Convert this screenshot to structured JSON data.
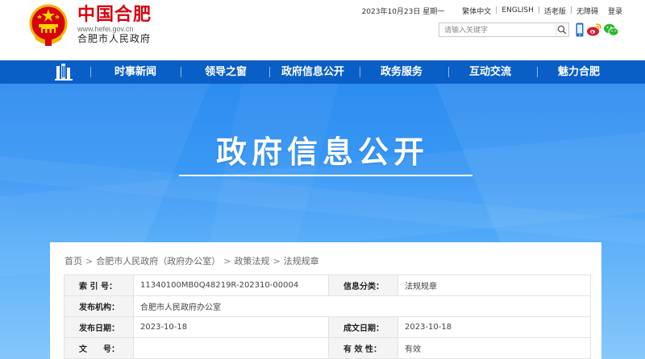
{
  "header": {
    "site_title": "中国合肥",
    "site_domain": "www.hefei.gov.cn",
    "site_subtitle": "合肥市人民政府",
    "date": "2023年10月23日 星期一",
    "links": [
      "繁体中文",
      "ENGLISH",
      "适老版",
      "无障碍"
    ],
    "login": "登录",
    "search_placeholder": "请输入关键字",
    "icons": [
      "search-icon",
      "mobile-icon",
      "weibo-icon",
      "wechat-icon"
    ]
  },
  "nav": {
    "items": [
      "时事新闻",
      "领导之窗",
      "政府信息公开",
      "政务服务",
      "互动交流",
      "魅力合肥"
    ]
  },
  "banner": {
    "title": "政府信息公开"
  },
  "breadcrumb": {
    "items": [
      "首页",
      "合肥市人民政府（政府办公室）",
      "政策法规",
      "法规规章"
    ],
    "separator": ">"
  },
  "info_table": {
    "rows": [
      {
        "label1": "索 引 号：",
        "value1": "11340100MB0Q48219R-202310-00004",
        "label2": "信息分类：",
        "value2": "法规规章"
      },
      {
        "label1": "发布机构：",
        "value1": "合肥市人民政府办公室"
      },
      {
        "label1": "发布日期：",
        "value1": "2023-10-18",
        "label2": "成文日期：",
        "value2": "2023-10-18"
      },
      {
        "label1": "文　　号：",
        "value1": "",
        "label2": "有 效 性：",
        "value2": "有效"
      }
    ]
  },
  "colors": {
    "brand_red": "#d7000f",
    "nav_blue": "#0a5fc6",
    "banner_blue": "#3b99f5"
  }
}
